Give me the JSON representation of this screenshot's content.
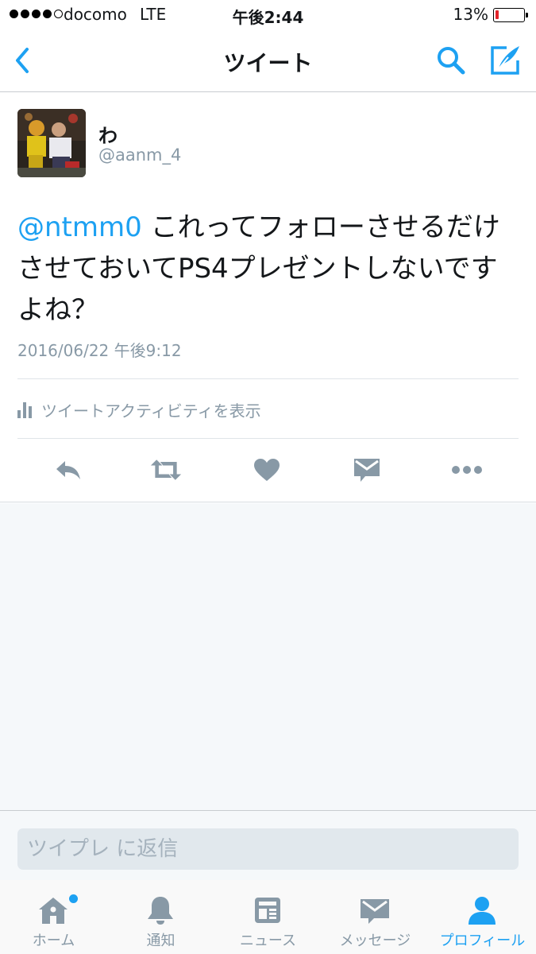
{
  "status_bar": {
    "carrier": "docomo",
    "network": "LTE",
    "time": "午後2:44",
    "battery_percent": "13%",
    "battery_level": 0.13,
    "battery_color": "#e3242b",
    "signal_bars_filled": 4,
    "signal_bars_total": 5
  },
  "nav": {
    "title": "ツイート",
    "back_icon": "chevron-left-icon",
    "search_icon": "search-icon",
    "compose_icon": "compose-icon",
    "accent_color": "#1da1f2"
  },
  "tweet": {
    "display_name": "わ",
    "screen_name": "@aanm_4",
    "mention": "@ntmm0",
    "text": " これってフォローさせるだけさせておいてPS4プレゼントしないですよね？",
    "timestamp": "2016/06/22 午後9:12",
    "activity_label": "ツイートアクティビティを表示",
    "actions": [
      "reply-icon",
      "retweet-icon",
      "like-icon",
      "direct-message-icon",
      "more-icon"
    ]
  },
  "reply": {
    "placeholder": "ツイプレ に返信"
  },
  "tab_bar": {
    "tabs": [
      {
        "label": "ホーム",
        "icon": "home-icon",
        "active": false,
        "has_notification_dot": true
      },
      {
        "label": "通知",
        "icon": "bell-icon",
        "active": false
      },
      {
        "label": "ニュース",
        "icon": "news-icon",
        "active": false
      },
      {
        "label": "メッセージ",
        "icon": "envelope-icon",
        "active": false
      },
      {
        "label": "プロフィール",
        "icon": "person-icon",
        "active": true
      }
    ]
  }
}
